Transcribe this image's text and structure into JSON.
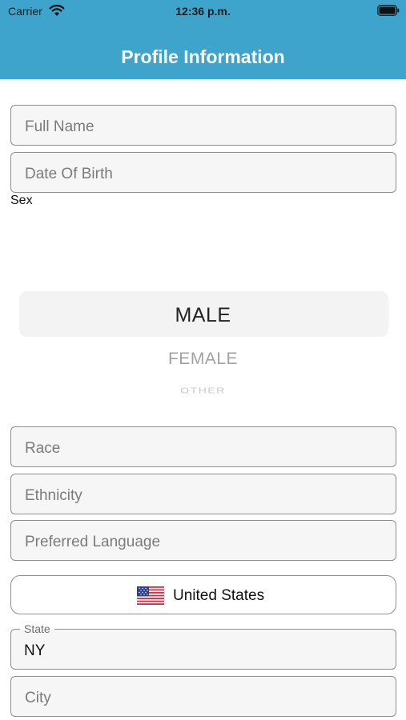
{
  "status_bar": {
    "carrier": "Carrier",
    "time": "12:36 p.m."
  },
  "header": {
    "title": "Profile Information",
    "background_color": "#3fa4cb"
  },
  "form": {
    "full_name": {
      "placeholder": "Full Name",
      "value": ""
    },
    "date_of_birth": {
      "placeholder": "Date Of Birth",
      "value": ""
    },
    "sex": {
      "label": "Sex",
      "options": [
        "MALE",
        "FEMALE",
        "OTHER"
      ],
      "selected": "MALE"
    },
    "race": {
      "placeholder": "Race",
      "value": ""
    },
    "ethnicity": {
      "placeholder": "Ethnicity",
      "value": ""
    },
    "preferred_language": {
      "placeholder": "Preferred Language",
      "value": ""
    },
    "country": {
      "flag_icon": "us-flag-icon",
      "name": "United States"
    },
    "state": {
      "label": "State",
      "value": "NY"
    },
    "city": {
      "placeholder": "City",
      "value": ""
    }
  }
}
